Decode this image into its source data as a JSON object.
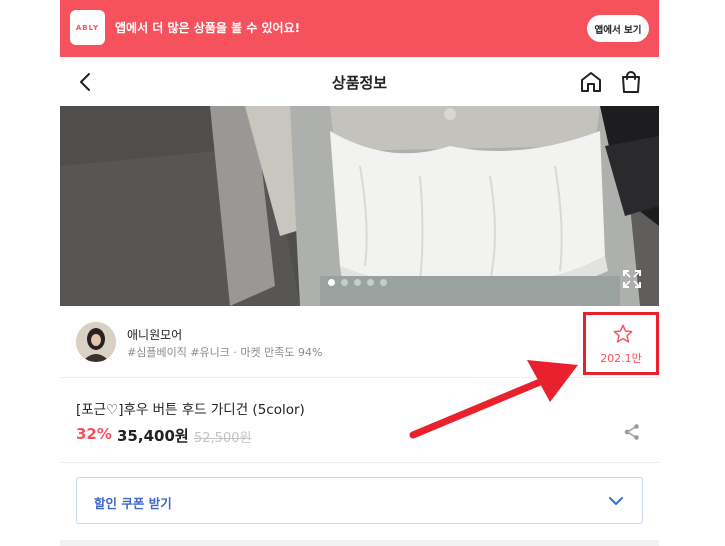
{
  "banner": {
    "logo_text": "ABLY",
    "message": "앱에서 더 많은 상품을 볼 수 있어요!",
    "cta_label": "앱에서 보기",
    "color": "#f5525e"
  },
  "header": {
    "title": "상품정보",
    "icons": [
      "chevron-left-icon",
      "home-icon",
      "shopping-bag-icon"
    ]
  },
  "gallery": {
    "total_images": 5,
    "current_index": 1
  },
  "seller": {
    "name": "애니원모어",
    "tags": "#심플베이직 #유니크 · 마켓 만족도 94%",
    "like_count": "202.1만"
  },
  "product": {
    "name": "[포근♡]후우 버튼 후드 가디건 (5color)",
    "discount": "32%",
    "price": "35,400원",
    "original_price": "52,500원"
  },
  "coupon": {
    "label": "할인 쿠폰 받기",
    "color": "#3f68c9"
  },
  "annotation": {
    "highlight_color": "#e8212c"
  }
}
